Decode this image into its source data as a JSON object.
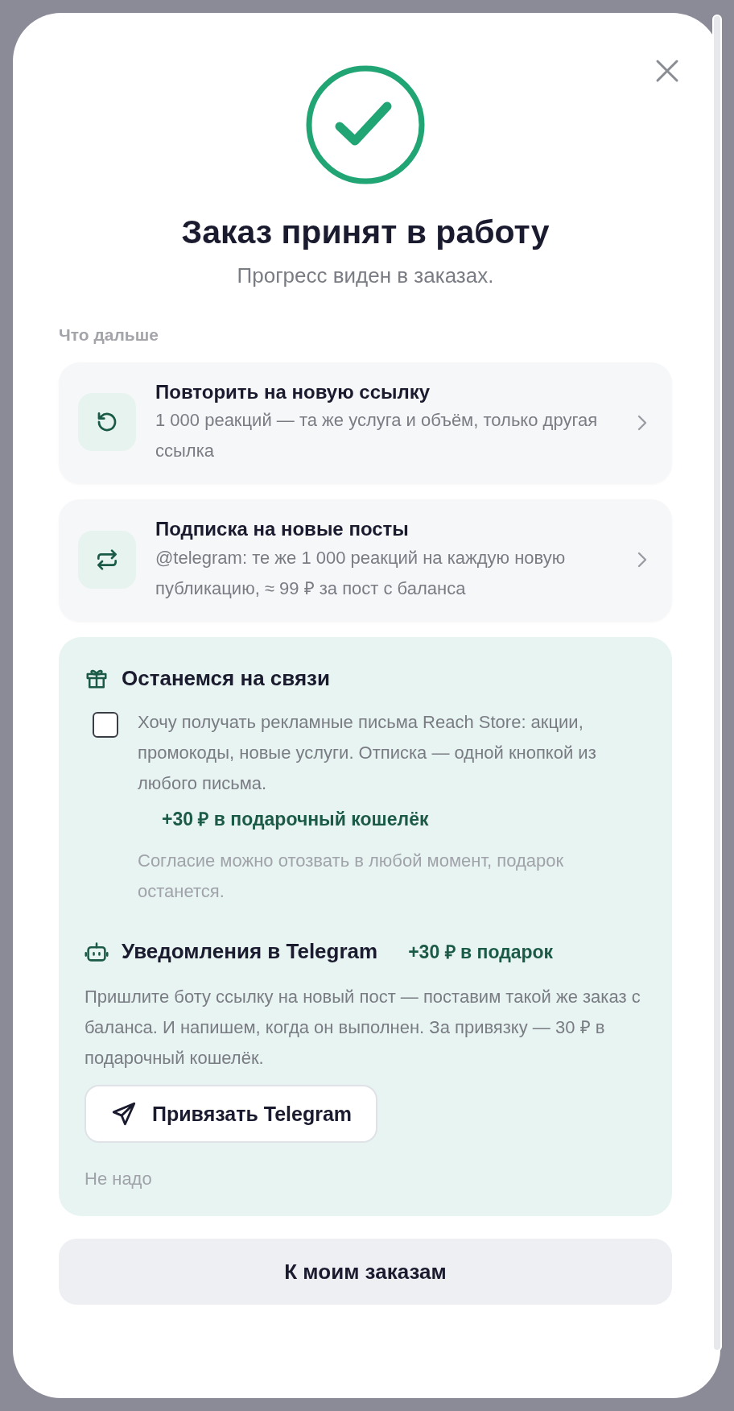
{
  "title": "Заказ принят в работу",
  "subtitle": "Прогресс виден в заказах.",
  "section_label": "Что дальше",
  "actions": [
    {
      "kind": "retry",
      "title": "Повторить на новую ссылку",
      "description": "1 000 реакций — та же услуга и объём, только другая ссылка"
    },
    {
      "kind": "recurring",
      "title": "Подписка на новые посты",
      "description": "@telegram: те же 1 000 реакций на каждую новую публикацию, ≈ 99 ₽ за пост с баланса"
    }
  ],
  "promo": {
    "title": "Останемся на связи",
    "consent": {
      "checked": false,
      "label": "Хочу получать рекламные письма Reach Store: акции, промокоды, новые услуги. Отписка — одной кнопкой из любого письма.",
      "bonus": "+30 ₽ в подарочный кошелёк",
      "note": "Согласие можно отозвать в любой момент, подарок останется."
    },
    "telegram": {
      "title": "Уведомления в Telegram",
      "bonus": "+30 ₽ в подарок",
      "description": "Пришлите боту ссылку на новый пост — поставим такой же заказ с баланса. И напишем, когда он выполнен. За привязку — 30 ₽ в подарочный кошелёк.",
      "button": "Привязать Telegram",
      "dismiss": "Не надо"
    }
  },
  "primary_button": "К моим заказам"
}
